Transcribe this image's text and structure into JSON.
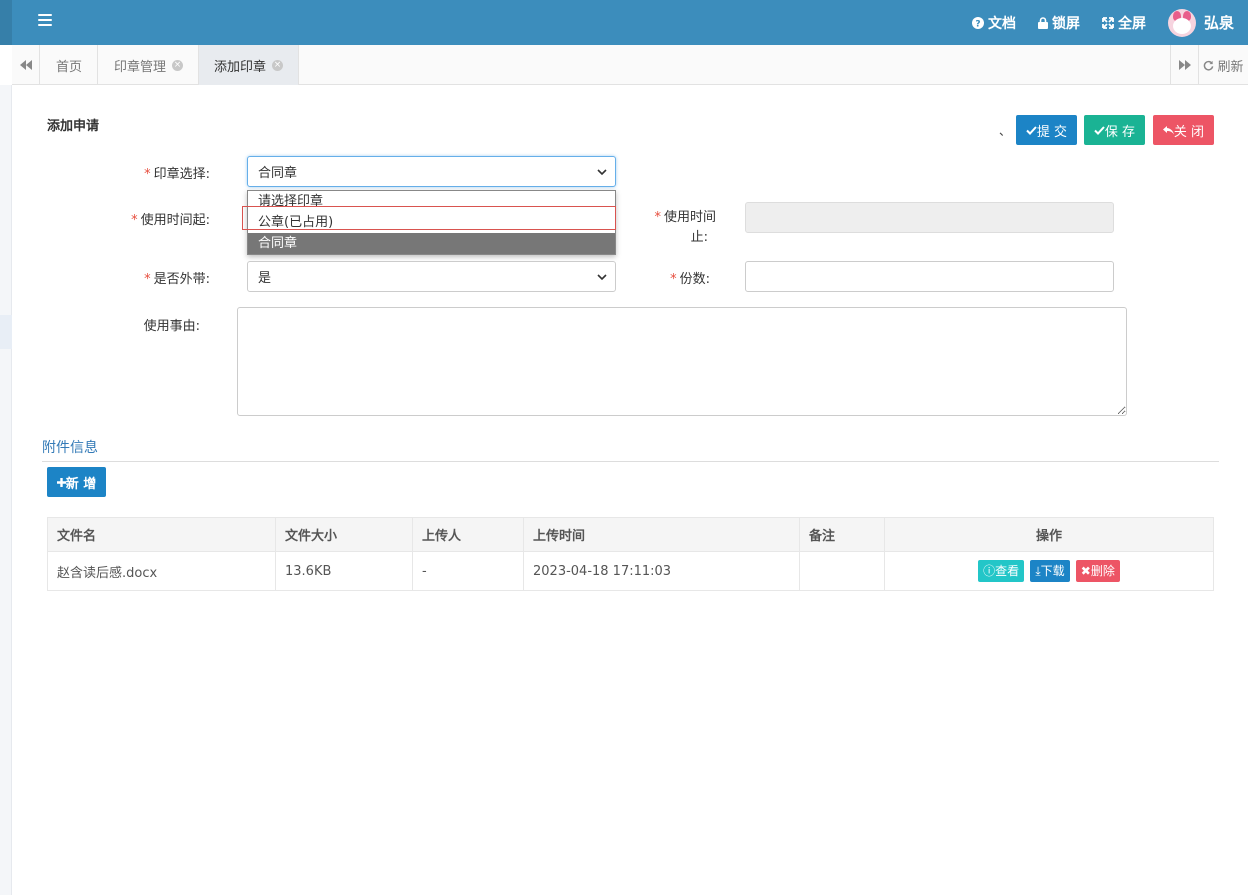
{
  "topbar": {
    "docs": "文档",
    "lock": "锁屏",
    "fullscreen": "全屏",
    "user": "弘泉"
  },
  "tabs": [
    {
      "label": "首页"
    },
    {
      "label": "印章管理"
    },
    {
      "label": "添加印章"
    }
  ],
  "refresh_label": "刷新",
  "form": {
    "title": "添加申请",
    "mark": "、",
    "submit": "提 交",
    "save": "保 存",
    "close": "关 闭",
    "seal_label": "印章选择:",
    "seal_value": "合同章",
    "seal_options": [
      "请选择印章",
      "公章(已占用)",
      "合同章"
    ],
    "start_label": "使用时间起:",
    "end_label": "使用时间\n止:",
    "end_label_1": "使用时间",
    "end_label_2": "止:",
    "external_label": "是否外带:",
    "external_value": "是",
    "copies_label": "份数:",
    "reason_label": "使用事由:"
  },
  "attachments": {
    "title": "附件信息",
    "add": "新 增",
    "columns": [
      "文件名",
      "文件大小",
      "上传人",
      "上传时间",
      "备注",
      "操作"
    ],
    "rows": [
      {
        "name": "赵含读后感.docx",
        "size": "13.6KB",
        "uploader": "-",
        "time": "2023-04-18 17:11:03",
        "note": "",
        "view": "查看",
        "download": "下载",
        "delete": "删除"
      }
    ]
  },
  "colors": {
    "topbar": "#3c8dbc",
    "primary": "#1c84c6",
    "success": "#1ab394",
    "danger": "#ed5565",
    "info": "#23c6c8"
  }
}
